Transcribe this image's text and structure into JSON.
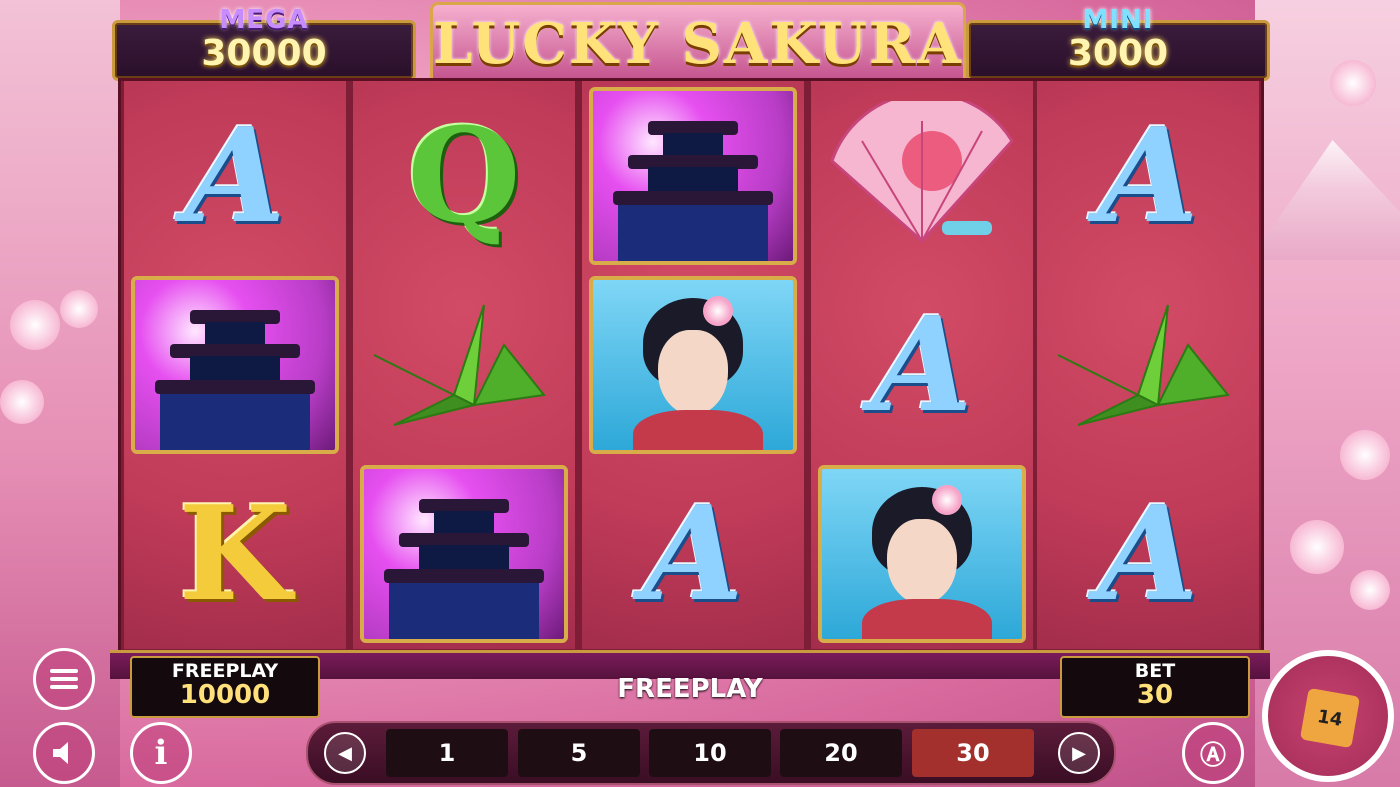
{
  "jackpots": {
    "mega": {
      "title": "MEGA",
      "value": "30000"
    },
    "mini": {
      "title": "MINI",
      "value": "3000"
    }
  },
  "logo": {
    "text": "LUCKY SAKURA"
  },
  "reels": [
    [
      "A",
      "pagoda",
      "K"
    ],
    [
      "Q",
      "crane",
      "pagoda"
    ],
    [
      "pagoda",
      "geisha",
      "A"
    ],
    [
      "fan",
      "A",
      "geisha"
    ],
    [
      "A",
      "crane",
      "A"
    ]
  ],
  "panel": {
    "freeplay_label": "FREEPLAY",
    "freeplay_value": "10000",
    "status_text": "FREEPLAY",
    "bet_label": "BET",
    "bet_value": "30"
  },
  "bet_options": [
    "1",
    "5",
    "10",
    "20",
    "30"
  ],
  "selected_bet": "30",
  "spin_badge": {
    "top": "1",
    "bottom": "4"
  },
  "icons": [
    "menu-icon",
    "sound-icon",
    "info-icon",
    "prev-arrow-icon",
    "next-arrow-icon",
    "autoplay-icon",
    "spin-icon"
  ],
  "colors": {
    "accent_gold": "#c99a3e",
    "reel_red": "#bf3b58",
    "selected_bet": "#a3302d"
  }
}
